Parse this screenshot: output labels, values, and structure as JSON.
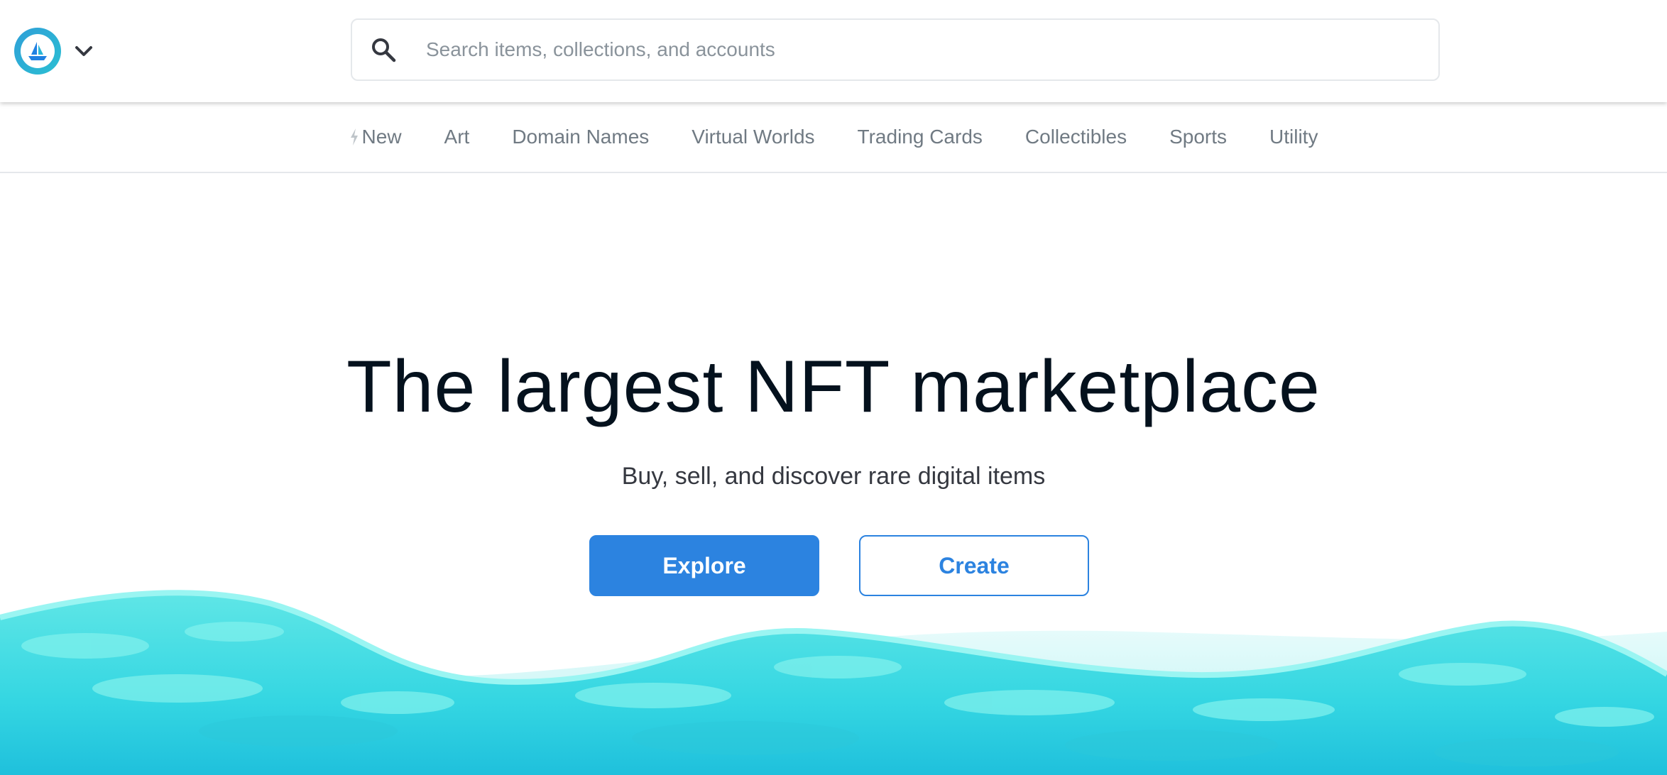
{
  "header": {
    "logo_icon": "opensea-boat-logo",
    "menu_icon": "chevron-down-icon",
    "search": {
      "placeholder": "Search items, collections, and accounts",
      "value": "",
      "icon": "search-icon"
    }
  },
  "categories": [
    {
      "label": "New",
      "icon": "lightning-icon"
    },
    {
      "label": "Art"
    },
    {
      "label": "Domain Names"
    },
    {
      "label": "Virtual Worlds"
    },
    {
      "label": "Trading Cards"
    },
    {
      "label": "Collectibles"
    },
    {
      "label": "Sports"
    },
    {
      "label": "Utility"
    }
  ],
  "hero": {
    "title": "The largest NFT marketplace",
    "subtitle": "Buy, sell, and discover rare digital items",
    "explore_label": "Explore",
    "create_label": "Create"
  },
  "colors": {
    "accent": "#2c83e0",
    "wave_light": "#7ff0ec",
    "wave_dark": "#1fc9dc",
    "text_primary": "#04111d",
    "text_muted": "#707a83"
  }
}
